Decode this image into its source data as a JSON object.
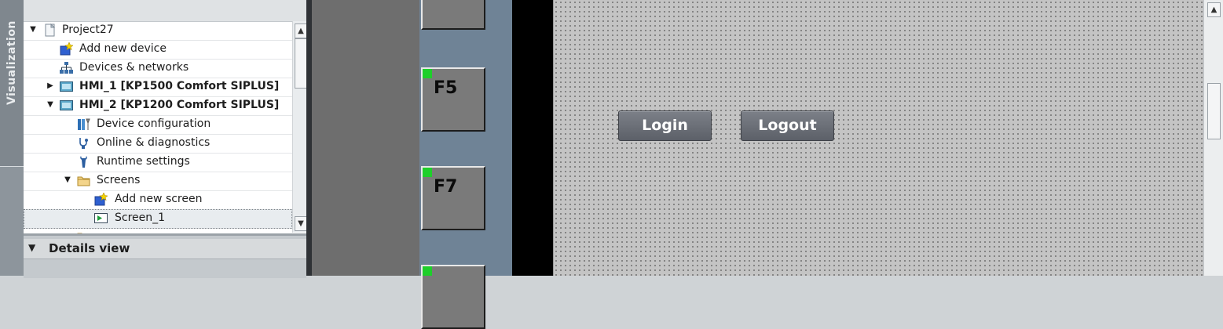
{
  "side_tab": {
    "label": "Visualization"
  },
  "tree": {
    "items": [
      {
        "label": "Project27",
        "bold": false
      },
      {
        "label": "Add new device",
        "bold": false
      },
      {
        "label": "Devices & networks",
        "bold": false
      },
      {
        "label": "HMI_1 [KP1500 Comfort SIPLUS]",
        "bold": true
      },
      {
        "label": "HMI_2 [KP1200 Comfort SIPLUS]",
        "bold": true
      },
      {
        "label": "Device configuration",
        "bold": false
      },
      {
        "label": "Online & diagnostics",
        "bold": false
      },
      {
        "label": "Runtime settings",
        "bold": false
      },
      {
        "label": "Screens",
        "bold": false
      },
      {
        "label": "Add new screen",
        "bold": false
      },
      {
        "label": "Screen_1",
        "bold": false
      }
    ],
    "selected_index": 10
  },
  "details": {
    "title": "Details view"
  },
  "hmi": {
    "function_keys": [
      "F5",
      "F7"
    ],
    "led_color": "#1ecf2a",
    "strip_color": "#6f8396"
  },
  "screen": {
    "buttons": {
      "login": "Login",
      "logout": "Logout"
    }
  },
  "icons": {
    "expanded": "triangle-down-icon",
    "collapsed": "triangle-right-icon",
    "scroll_up": "scroll-up-icon",
    "scroll_down": "scroll-down-icon"
  }
}
